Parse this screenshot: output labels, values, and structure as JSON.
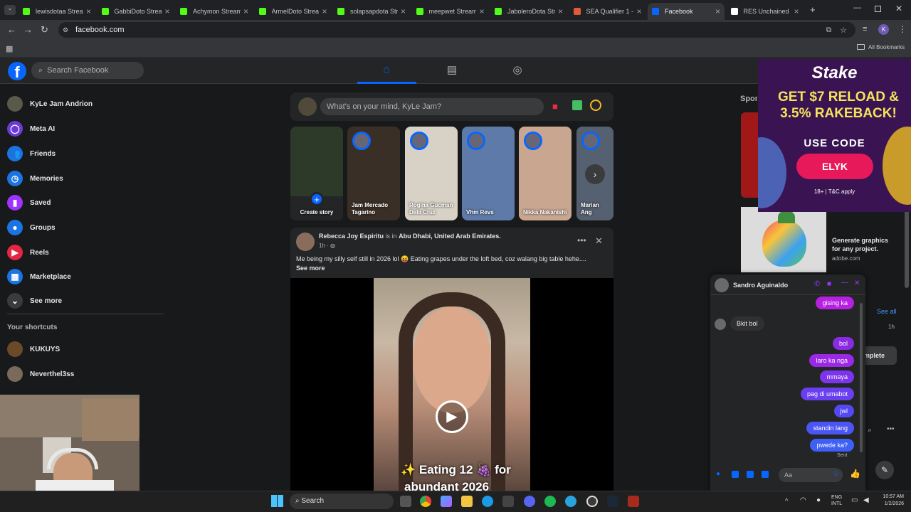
{
  "browser": {
    "tabs": [
      {
        "title": "lewisdotaa Stream",
        "color": "#53fc18"
      },
      {
        "title": "GabbiDoto Stream",
        "color": "#53fc18"
      },
      {
        "title": "Achymon Stream",
        "color": "#53fc18"
      },
      {
        "title": "ArmelDoto Stream",
        "color": "#53fc18"
      },
      {
        "title": "solapsapdota Stream",
        "color": "#53fc18"
      },
      {
        "title": "meepwet Stream",
        "color": "#53fc18"
      },
      {
        "title": "JaboleroDota Stream",
        "color": "#53fc18"
      },
      {
        "title": "SEA Qualifier 1 - Kick",
        "color": "#e05a3a"
      },
      {
        "title": "Facebook",
        "color": "#0866ff"
      },
      {
        "title": "RES Unchained 3",
        "color": "#ffffff"
      }
    ],
    "url": "facebook.com",
    "all_bookmarks": "All Bookmarks",
    "profile_initial": "K"
  },
  "fb": {
    "logo": "f",
    "search_placeholder": "Search Facebook",
    "sidebar": [
      {
        "label": "KyLe Jam Andrion",
        "icon": "avatar",
        "color": "#5a5a4a"
      },
      {
        "label": "Meta AI",
        "icon": "meta-ai-icon",
        "color": "#6b3bd6"
      },
      {
        "label": "Friends",
        "icon": "friends-icon",
        "color": "#1b74e4"
      },
      {
        "label": "Memories",
        "icon": "memories-icon",
        "color": "#1b74e4"
      },
      {
        "label": "Saved",
        "icon": "saved-icon",
        "color": "#a033ff"
      },
      {
        "label": "Groups",
        "icon": "groups-icon",
        "color": "#1b74e4"
      },
      {
        "label": "Reels",
        "icon": "reels-icon",
        "color": "#e42645"
      },
      {
        "label": "Marketplace",
        "icon": "marketplace-icon",
        "color": "#1b74e4"
      },
      {
        "label": "See more",
        "icon": "chevron-down-icon",
        "color": "#3a3b3c"
      }
    ],
    "shortcuts_header": "Your shortcuts",
    "shortcuts": [
      {
        "label": "KUKUYS",
        "color": "#6b4a2a"
      },
      {
        "label": "Neverthel3ss",
        "color": "#7a6a5a"
      }
    ],
    "composer_placeholder": "What's on your mind, KyLe Jam?",
    "stories": [
      {
        "name": "Create story",
        "color": "#2d3a2a"
      },
      {
        "name": "Jam Mercado Tagarino",
        "color": "#3a2f26"
      },
      {
        "name": "Rogina Gucman Dela Cruz",
        "color": "#d8d2c6"
      },
      {
        "name": "Vhm Revs",
        "color": "#5d7aa8"
      },
      {
        "name": "Nikka Nakanishi",
        "color": "#c9a690"
      },
      {
        "name": "Marian Ang",
        "color": "#556070"
      }
    ],
    "post": {
      "author": "Rebecca Joy Espiritu",
      "is_in": "is in",
      "location": "Abu Dhabi, United Arab Emirates.",
      "time": "1h",
      "text": "Me being my silly self still in 2026 lol 😝 Eating grapes under the loft bed, coz walang big table hehe....",
      "see_more": "See more",
      "caption_line1": "✨ Eating 12 🍇 for",
      "caption_line2": "abundant 2026"
    },
    "right": {
      "sponsored": "Sponsored",
      "see_all": "See all",
      "time_1h": "1h",
      "complete": "Complete",
      "adobe_title": "Generate graphics for any project.",
      "adobe_domain": "adobe.com"
    }
  },
  "ad": {
    "brand": "Stake",
    "headline": "GET $7 RELOAD & 3.5% RAKEBACK!",
    "use_code": "USE CODE",
    "code": "ELYK",
    "disclaimer": "18+ | T&C apply"
  },
  "chat": {
    "contact": "Sandro Aguinaldo",
    "incoming": "Bkit bol",
    "messages_top": "gising ka",
    "messages": [
      "bol",
      "laro ka nga",
      "mmaya",
      "pag di umabot",
      "jwl",
      "standin lang",
      "pwede ka?"
    ],
    "status": "Sent",
    "input_placeholder": "Aa"
  },
  "taskbar": {
    "search": "Search",
    "lang1": "ENG",
    "lang2": "INTL",
    "time": "10:57 AM",
    "date": "1/2/2026"
  }
}
